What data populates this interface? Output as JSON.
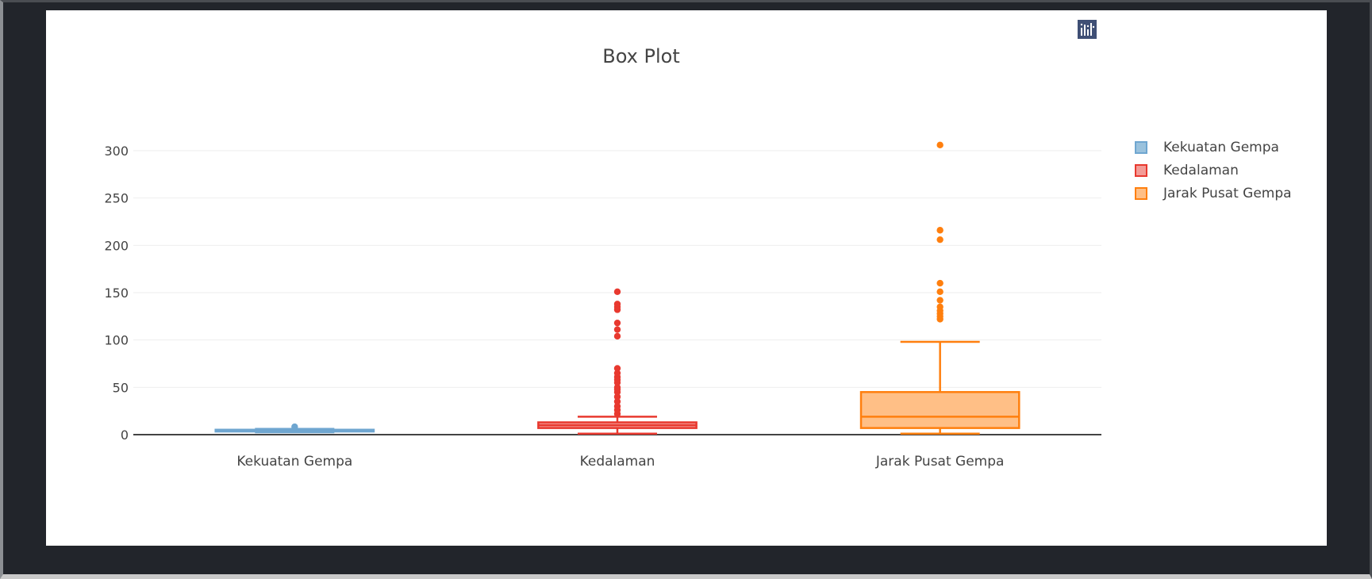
{
  "chart_data": {
    "type": "box",
    "title": "Box Plot",
    "xlabel": "",
    "ylabel": "",
    "ylim": [
      0,
      325
    ],
    "y_ticks": [
      0,
      50,
      100,
      150,
      200,
      250,
      300
    ],
    "categories": [
      "Kekuatan Gempa",
      "Kedalaman",
      "Jarak Pusat Gempa"
    ],
    "series": [
      {
        "name": "Kekuatan Gempa",
        "color": "#1f77b4",
        "whisker_low": 2.5,
        "q1": 3.3,
        "median": 4.3,
        "q3": 5.2,
        "whisker_high": 6.1,
        "outliers": [
          8.3
        ]
      },
      {
        "name": "Kedalaman",
        "color": "#e8392f",
        "whisker_low": 1,
        "q1": 7,
        "median": 10,
        "q3": 13,
        "whisker_high": 19,
        "outliers": [
          22,
          26,
          30,
          35,
          40,
          45,
          48,
          50,
          55,
          58,
          61,
          65,
          70,
          104,
          111,
          118,
          132,
          135,
          138,
          151
        ]
      },
      {
        "name": "Jarak Pusat Gempa",
        "color": "#ff7f0e",
        "whisker_low": 1,
        "q1": 7,
        "median": 19,
        "q3": 45,
        "whisker_high": 98,
        "outliers": [
          122,
          125,
          128,
          131,
          135,
          142,
          151,
          160,
          206,
          216,
          306
        ]
      }
    ],
    "legend_position": "top-right",
    "grid": true
  },
  "toolbar": {
    "icons": [
      "camera-icon",
      "zoom-icon",
      "pan-icon",
      "zoom-in-icon",
      "zoom-out-icon",
      "autoscale-icon",
      "reset-axes-icon",
      "plotly-logo-icon"
    ]
  }
}
